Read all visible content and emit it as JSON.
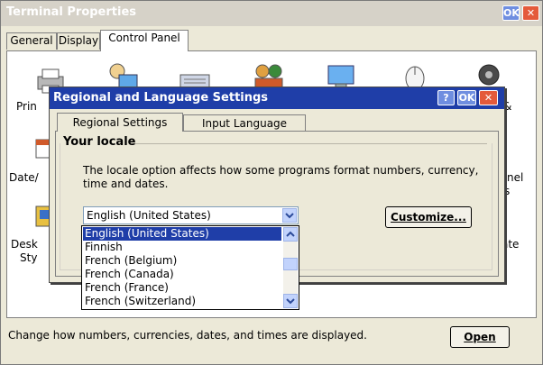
{
  "window": {
    "title": "Terminal Properties",
    "ok_label": "OK",
    "close_label": "✕",
    "tabs": [
      "General",
      "Display",
      "Control Panel"
    ],
    "active_tab": "Control Panel"
  },
  "control_panel": {
    "items": [
      {
        "label": "Prin",
        "icon": "printer-icon"
      },
      {
        "label": "",
        "icon": "network-icon"
      },
      {
        "label": "",
        "icon": "keyboard-icon"
      },
      {
        "label": "",
        "icon": "users-icon"
      },
      {
        "label": "",
        "icon": "display-icon"
      },
      {
        "label": "",
        "icon": "mouse-icon"
      },
      {
        "label": "&",
        "icon": "sounds-icon"
      },
      {
        "label": "Date/",
        "icon": "calendar-icon"
      },
      {
        "label": "nel",
        "icon": "panel-icon"
      },
      {
        "label": "s",
        "icon": ""
      },
      {
        "label": "Desk",
        "icon": "desktop-icon"
      },
      {
        "label": "Sty",
        "icon": ""
      },
      {
        "label": "ate",
        "icon": ""
      }
    ],
    "status_text": "Change how numbers, currencies, dates, and times are displayed.",
    "open_label": "Open"
  },
  "dialog": {
    "title": "Regional and Language Settings",
    "help_label": "?",
    "ok_label": "OK",
    "close_label": "✕",
    "tabs": [
      "Regional Settings",
      "Input Language"
    ],
    "active_tab": "Regional Settings",
    "group_title": "Your locale",
    "description": "The locale option affects how some programs format numbers, currency, time and dates.",
    "locale_value": "English (United States)",
    "customize_label": "Customize...",
    "locale_options": [
      "English (United States)",
      "Finnish",
      "French (Belgium)",
      "French (Canada)",
      "French (France)",
      "French (Switzerland)"
    ],
    "selected_index": 0
  },
  "colors": {
    "dialog_titlebar": "#1f3ea8",
    "selection": "#1f3ea8",
    "window_face": "#ece9d8",
    "close_button": "#e45a3b",
    "ok_button": "#6f8ee0"
  }
}
